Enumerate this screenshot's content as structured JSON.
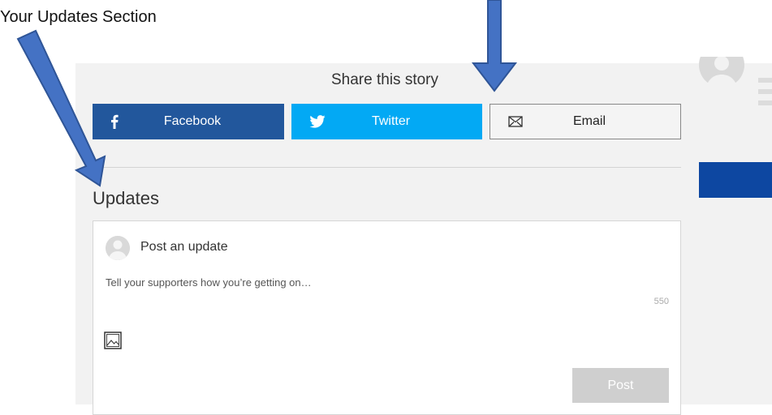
{
  "annotation": {
    "text": "Your Updates Section"
  },
  "share": {
    "title": "Share this story",
    "facebook_label": "Facebook",
    "twitter_label": "Twitter",
    "email_label": "Email"
  },
  "updates": {
    "heading": "Updates",
    "post_label": "Post an update",
    "placeholder": "Tell your supporters how you’re getting on…",
    "char_count": "550",
    "post_button": "Post"
  },
  "icons": {
    "facebook": "facebook-icon",
    "twitter": "twitter-icon",
    "email": "envelope-icon",
    "avatar": "user-avatar-icon",
    "image": "image-upload-icon"
  },
  "colors": {
    "facebook": "#22579c",
    "twitter": "#03a9f4",
    "annotation_arrow": "#4472c4",
    "right_button": "#0d47a1"
  }
}
